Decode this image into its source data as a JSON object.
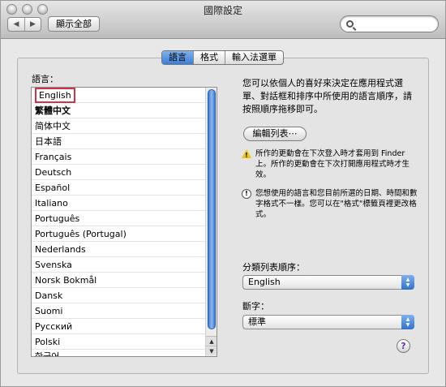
{
  "window": {
    "title": "國際設定"
  },
  "toolbar": {
    "show_all_label": "顯示全部",
    "back_glyph": "◀",
    "forward_glyph": "▶"
  },
  "tabs": [
    {
      "label": "語言",
      "active": true
    },
    {
      "label": "格式",
      "active": false
    },
    {
      "label": "輸入法選單",
      "active": false
    }
  ],
  "language_label": "語言：",
  "languages": [
    "English",
    "繁體中文",
    "简体中文",
    "日本語",
    "Français",
    "Deutsch",
    "Español",
    "Italiano",
    "Português",
    "Português (Portugal)",
    "Nederlands",
    "Svenska",
    "Norsk Bokmål",
    "Dansk",
    "Suomi",
    "Русский",
    "Polski",
    "한국어"
  ],
  "description": "您可以依個人的喜好來決定在應用程式選單、對話框和排序中所使用的語言順序，請按照順序拖移即可。",
  "edit_list_label": "編輯列表⋯",
  "notes": {
    "warning": "所作的更動會在下次登入時才套用到 Finder 上。所作的更動會在下次打開應用程式時才生效。",
    "info": "您想使用的語言和您目前所選的日期、時間和數字格式不一樣。您可以在\"格式\"標籤頁裡更改格式。"
  },
  "sort_order": {
    "label": "分類列表順序：",
    "value": "English"
  },
  "numbers": {
    "label": "斷字：",
    "value": "標準"
  },
  "help_label": "?",
  "colors": {
    "selection_border": "#d3324a",
    "accent": "#3a7fd8",
    "warning": "#f2c500"
  }
}
